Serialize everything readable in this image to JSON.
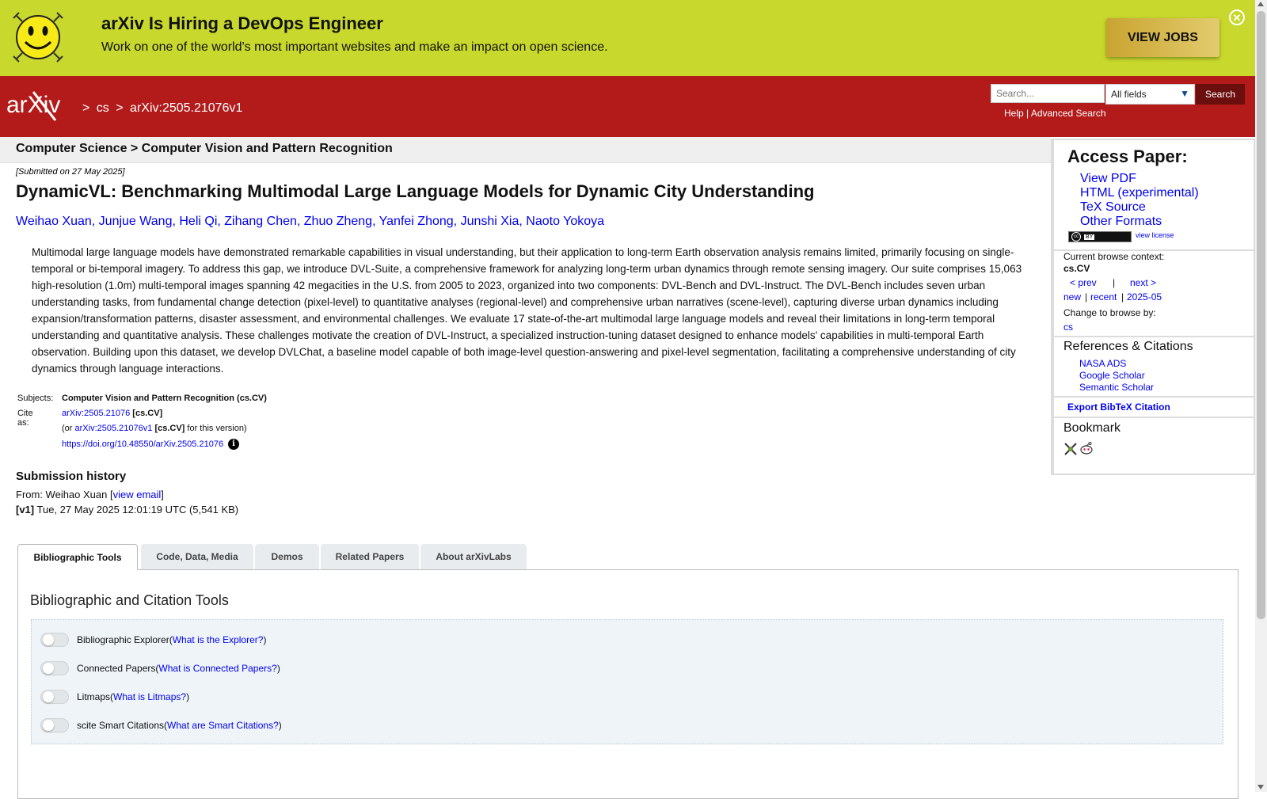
{
  "banner": {
    "title": "arXiv Is Hiring a DevOps Engineer",
    "subtitle": "Work on one of the world's most important websites and make an impact on open science.",
    "button": "VIEW JOBS",
    "close_icon": "close-circle-icon",
    "logo_icon": "smiley-icon",
    "bg_color": "#c8d82c"
  },
  "header": {
    "logo_text": "arXiv",
    "breadcrumbs": [
      ">",
      "cs",
      ">",
      "arXiv:2505.21076v1"
    ],
    "search_placeholder": "Search...",
    "field_select": "All fields",
    "search_button": "Search",
    "help": "Help",
    "separator": "|",
    "advanced": "Advanced Search",
    "bg_color": "#b31b1b"
  },
  "paper": {
    "category_path": "Computer Science > Computer Vision and Pattern Recognition",
    "submitted": "[Submitted on 27 May 2025]",
    "title": "DynamicVL: Benchmarking Multimodal Large Language Models for Dynamic City Understanding",
    "authors": [
      "Weihao Xuan",
      "Junjue Wang",
      "Heli Qi",
      "Zihang Chen",
      "Zhuo Zheng",
      "Yanfei Zhong",
      "Junshi Xia",
      "Naoto Yokoya"
    ],
    "author_sep": ", ",
    "abstract": "Multimodal large language models have demonstrated remarkable capabilities in visual understanding, but their application to long-term Earth observation analysis remains limited, primarily focusing on single-temporal or bi-temporal imagery. To address this gap, we introduce DVL-Suite, a comprehensive framework for analyzing long-term urban dynamics through remote sensing imagery. Our suite comprises 15,063 high-resolution (1.0m) multi-temporal images spanning 42 megacities in the U.S. from 2005 to 2023, organized into two components: DVL-Bench and DVL-Instruct. The DVL-Bench includes seven urban understanding tasks, from fundamental change detection (pixel-level) to quantitative analyses (regional-level) and comprehensive urban narratives (scene-level), capturing diverse urban dynamics including expansion/transformation patterns, disaster assessment, and environmental challenges. We evaluate 17 state-of-the-art multimodal large language models and reveal their limitations in long-term temporal understanding and quantitative analysis. These challenges motivate the creation of DVL-Instruct, a specialized instruction-tuning dataset designed to enhance models' capabilities in multi-temporal Earth observation. Building upon this dataset, we develop DVLChat, a baseline model capable of both image-level question-answering and pixel-level segmentation, facilitating a comprehensive understanding of city dynamics through language interactions.",
    "subjects_label": "Subjects:",
    "subjects_value": "Computer Vision and Pattern Recognition (cs.CV)",
    "cite_label": "Cite as:",
    "cite_id": "arXiv:2505.21076",
    "cite_cat": "[cs.CV]",
    "cite_or": "(or",
    "cite_version_id": "arXiv:2505.21076v1",
    "cite_version_cat": "[cs.CV]",
    "cite_version_suffix": "for this version)",
    "doi": "https://doi.org/10.48550/arXiv.2505.21076",
    "doi_info_icon": "info-icon",
    "history_title": "Submission history",
    "history_from_label": "From: Weihao Xuan [",
    "history_view_email": "view email",
    "history_from_close": "]",
    "history_v1_label": "[v1]",
    "history_v1_text": "Tue, 27 May 2025 12:01:19 UTC (5,541 KB)"
  },
  "sidebar": {
    "access_title": "Access Paper:",
    "access_links": [
      "View PDF",
      "HTML (experimental)",
      "TeX Source",
      "Other Formats"
    ],
    "license_badge": "BY",
    "view_license": "view license",
    "browse_context_label": "Current browse context:",
    "browse_context": "cs.CV",
    "prev": "< prev",
    "pipe": "|",
    "next": "next >",
    "new": "new",
    "recent": "recent",
    "month": "2025-05",
    "change_browse": "Change to browse by:",
    "browse_cs": "cs",
    "refs_title": "References & Citations",
    "refs_links": [
      "NASA ADS",
      "Google Scholar",
      "Semantic Scholar"
    ],
    "export_bibtex": "Export BibTeX Citation",
    "bookmark_title": "Bookmark",
    "bookmark_icons": [
      "bibsonomy-icon",
      "reddit-icon"
    ]
  },
  "tabs": {
    "items": [
      "Bibliographic Tools",
      "Code, Data, Media",
      "Demos",
      "Related Papers",
      "About arXivLabs"
    ],
    "active": 0
  },
  "tools": {
    "title": "Bibliographic and Citation Tools",
    "items": [
      {
        "name": "Bibliographic Explorer",
        "link": "What is the Explorer?"
      },
      {
        "name": "Connected Papers",
        "link": "What is Connected Papers?"
      },
      {
        "name": "Litmaps",
        "link": "What is Litmaps?"
      },
      {
        "name": "scite Smart Citations",
        "link": "What are Smart Citations?"
      }
    ],
    "open_paren": " (",
    "close_paren": ")"
  }
}
